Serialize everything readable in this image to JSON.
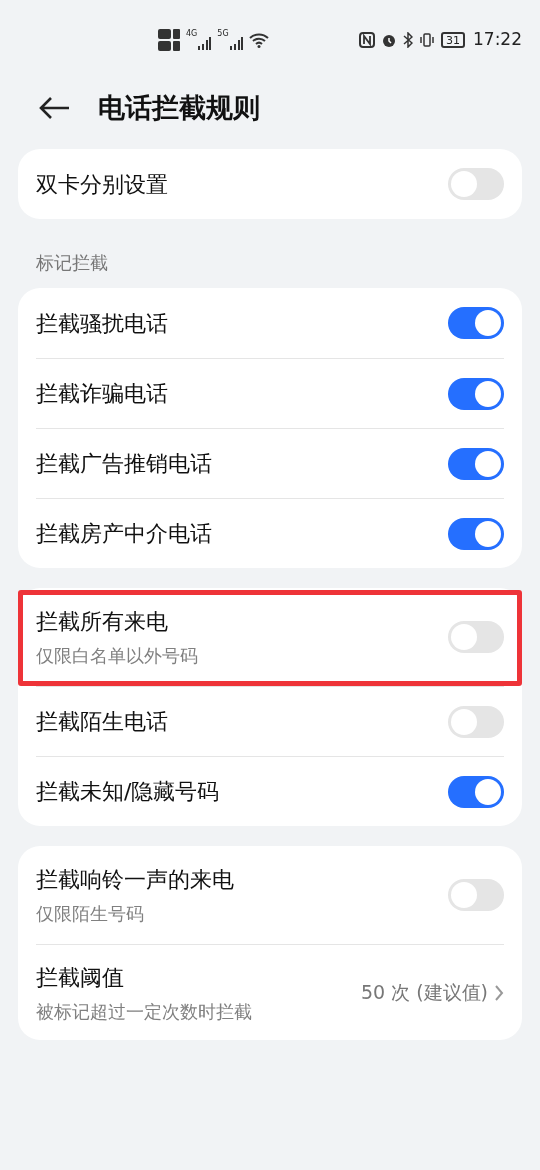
{
  "status_bar": {
    "net_1": "4G",
    "net_2": "5G",
    "battery": "31",
    "time": "17:22"
  },
  "header": {
    "title": "电话拦截规则"
  },
  "sections": [
    {
      "items": [
        {
          "kind": "toggle",
          "title": "双卡分别设置",
          "on": false,
          "highlighted": false
        }
      ]
    },
    {
      "label": "标记拦截",
      "items": [
        {
          "kind": "toggle",
          "title": "拦截骚扰电话",
          "on": true,
          "highlighted": false
        },
        {
          "kind": "toggle",
          "title": "拦截诈骗电话",
          "on": true,
          "highlighted": false
        },
        {
          "kind": "toggle",
          "title": "拦截广告推销电话",
          "on": true,
          "highlighted": false
        },
        {
          "kind": "toggle",
          "title": "拦截房产中介电话",
          "on": true,
          "highlighted": false
        }
      ]
    },
    {
      "items": [
        {
          "kind": "toggle",
          "title": "拦截所有来电",
          "subtitle": "仅限白名单以外号码",
          "on": false,
          "highlighted": true
        },
        {
          "kind": "toggle",
          "title": "拦截陌生电话",
          "on": false,
          "highlighted": false
        },
        {
          "kind": "toggle",
          "title": "拦截未知/隐藏号码",
          "on": true,
          "highlighted": false
        }
      ]
    },
    {
      "items": [
        {
          "kind": "toggle",
          "title": "拦截响铃一声的来电",
          "subtitle": "仅限陌生号码",
          "on": false,
          "highlighted": false
        },
        {
          "kind": "value",
          "title": "拦截阈值",
          "subtitle": "被标记超过一定次数时拦截",
          "value": "50 次 (建议值)",
          "highlighted": false
        }
      ]
    }
  ]
}
